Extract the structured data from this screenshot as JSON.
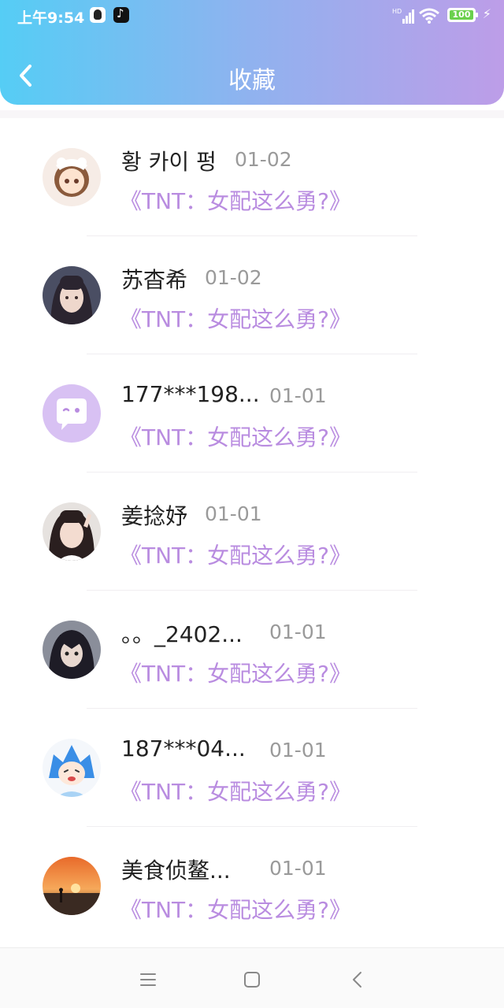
{
  "status_bar": {
    "time": "上午9:54",
    "battery": "100",
    "icons": [
      "qq-icon",
      "tiktok-icon",
      "signal-icon",
      "wifi-icon",
      "battery-icon",
      "charging-icon"
    ]
  },
  "header": {
    "title": "收藏",
    "back_icon": "chevron-left-icon"
  },
  "list": [
    {
      "name": "황 카이 펑",
      "date": "01-02",
      "book": "《TNT：女配这么勇?》",
      "avatar": "anime-girl"
    },
    {
      "name": "苏杳希",
      "date": "01-02",
      "book": "《TNT：女配这么勇?》",
      "avatar": "photo-girl"
    },
    {
      "name": "177***198...",
      "date": "01-01",
      "book": "《TNT：女配这么勇?》",
      "avatar": "default-chat"
    },
    {
      "name": "姜捻妤",
      "date": "01-01",
      "book": "《TNT：女配这么勇?》",
      "avatar": "photo-girl-peace"
    },
    {
      "name": "。。_2402...",
      "date": "01-01",
      "book": "《TNT：女配这么勇?》",
      "avatar": "anime-dark"
    },
    {
      "name": "187***04...",
      "date": "01-01",
      "book": "《TNT：女配这么勇?》",
      "avatar": "anime-blue"
    },
    {
      "name": "美食侦鳌...",
      "date": "01-01",
      "book": "《TNT：女配这么勇?》",
      "avatar": "sunset"
    }
  ],
  "colors": {
    "header_gradient": [
      "#55cdf5",
      "#bd9de8"
    ],
    "book_title": "#b98ce0",
    "date": "#9a9a9a"
  },
  "nav_bar": [
    "menu-icon",
    "home-square-icon",
    "back-icon"
  ]
}
